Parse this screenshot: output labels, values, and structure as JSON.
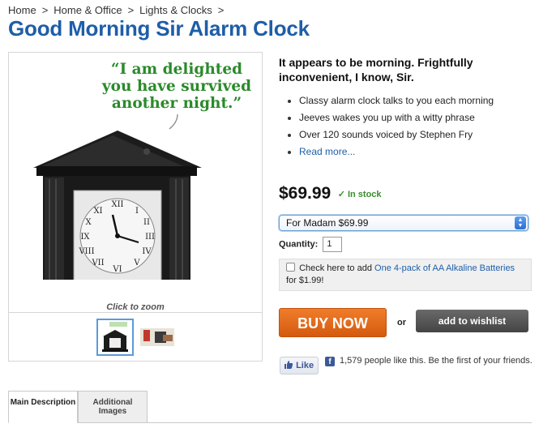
{
  "breadcrumb": {
    "items": [
      "Home",
      "Home & Office",
      "Lights & Clocks"
    ],
    "separator": ">"
  },
  "product": {
    "title": "Good Morning Sir Alarm Clock",
    "quote": "“I am delighted you have survived another night.”",
    "zoom_caption": "Click to zoom",
    "tagline": "It appears to be morning. Frightfully inconvenient, I know, Sir.",
    "features": [
      "Classy alarm clock talks to you each morning",
      "Jeeves wakes you up with a witty phrase",
      "Over 120 sounds voiced by Stephen Fry"
    ],
    "read_more": "Read more...",
    "price": "$69.99",
    "stock": "✓ In stock",
    "variant_selected": "For Madam $69.99",
    "quantity_label": "Quantity:",
    "quantity_value": "1",
    "addon": {
      "prefix": "Check here to add",
      "link": "One 4-pack of AA Alkaline Batteries",
      "price": "for $1.99!"
    },
    "buy_label": "BUY NOW",
    "or_label": "or",
    "wishlist_label": "add to wishlist"
  },
  "social": {
    "like_label": "Like",
    "like_text": "1,579 people like this. Be the first of your friends."
  },
  "tabs": [
    {
      "label": "Main Description"
    },
    {
      "label": "Additional Images"
    }
  ],
  "colors": {
    "title": "#1e5ea8",
    "quote": "#2a8a2a",
    "in_stock": "#3a8d2e",
    "buy_button": "#e06b1c",
    "wishlist_button": "#555555",
    "link": "#1e5ea8"
  },
  "icons": {
    "like": "thumbs-up-icon",
    "facebook": "facebook-icon",
    "select_arrows": "select-arrows-icon",
    "checkbox": "checkbox-icon"
  }
}
